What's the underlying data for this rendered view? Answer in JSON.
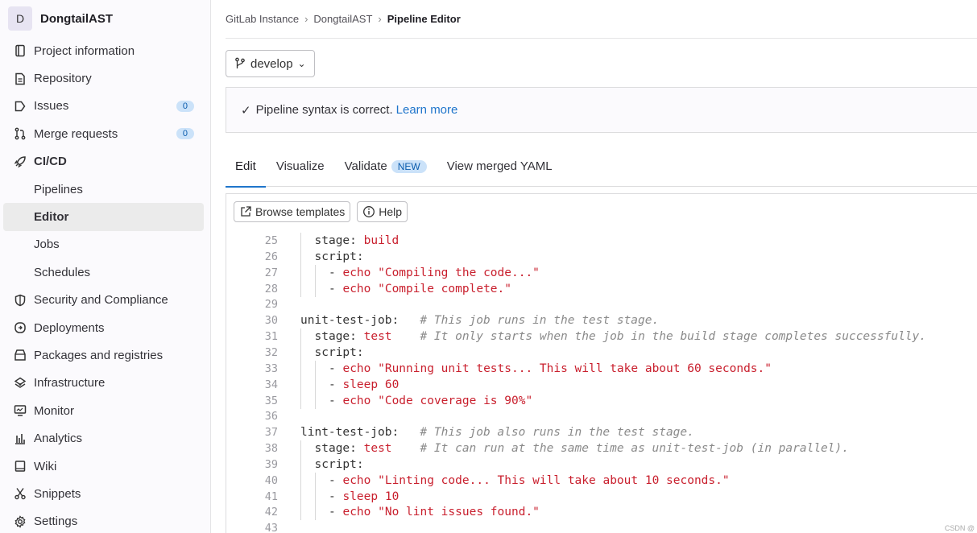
{
  "sidebar": {
    "project_initial": "D",
    "project_name": "DongtailAST",
    "items": [
      {
        "label": "Project information",
        "icon": "info-book-icon"
      },
      {
        "label": "Repository",
        "icon": "document-icon"
      },
      {
        "label": "Issues",
        "icon": "issues-icon",
        "badge": "0"
      },
      {
        "label": "Merge requests",
        "icon": "merge-request-icon",
        "badge": "0"
      },
      {
        "label": "CI/CD",
        "icon": "rocket-icon"
      },
      {
        "label": "Pipelines"
      },
      {
        "label": "Editor"
      },
      {
        "label": "Jobs"
      },
      {
        "label": "Schedules"
      },
      {
        "label": "Security and Compliance",
        "icon": "shield-icon"
      },
      {
        "label": "Deployments",
        "icon": "deployments-icon"
      },
      {
        "label": "Packages and registries",
        "icon": "package-icon"
      },
      {
        "label": "Infrastructure",
        "icon": "infrastructure-icon"
      },
      {
        "label": "Monitor",
        "icon": "monitor-icon"
      },
      {
        "label": "Analytics",
        "icon": "chart-icon"
      },
      {
        "label": "Wiki",
        "icon": "book-icon"
      },
      {
        "label": "Snippets",
        "icon": "scissors-icon"
      },
      {
        "label": "Settings",
        "icon": "gear-icon"
      }
    ]
  },
  "breadcrumb": {
    "items": [
      "GitLab Instance",
      "DongtailAST"
    ],
    "current": "Pipeline Editor"
  },
  "branch": {
    "label": "develop"
  },
  "status": {
    "text": "Pipeline syntax is correct.",
    "link": "Learn more"
  },
  "tabs": {
    "edit": "Edit",
    "visualize": "Visualize",
    "validate": "Validate",
    "validate_badge": "NEW",
    "merged": "View merged YAML"
  },
  "toolbar": {
    "browse": "Browse templates",
    "help": "Help"
  },
  "code_lines": [
    {
      "n": "25",
      "indent": 1,
      "parts": [
        [
          "k",
          "stage: "
        ],
        [
          "v",
          "build"
        ]
      ]
    },
    {
      "n": "26",
      "indent": 1,
      "parts": [
        [
          "k",
          "script:"
        ]
      ]
    },
    {
      "n": "27",
      "indent": 2,
      "parts": [
        [
          "k",
          "- "
        ],
        [
          "v",
          "echo \"Compiling the code...\""
        ]
      ]
    },
    {
      "n": "28",
      "indent": 2,
      "parts": [
        [
          "k",
          "- "
        ],
        [
          "v",
          "echo \"Compile complete.\""
        ]
      ]
    },
    {
      "n": "29",
      "indent": 0,
      "parts": []
    },
    {
      "n": "30",
      "indent": 0,
      "parts": [
        [
          "k",
          "unit-test-job:   "
        ],
        [
          "c",
          "# This job runs in the test stage."
        ]
      ]
    },
    {
      "n": "31",
      "indent": 1,
      "parts": [
        [
          "k",
          "stage: "
        ],
        [
          "v",
          "test"
        ],
        [
          "k",
          "    "
        ],
        [
          "c",
          "# It only starts when the job in the build stage completes successfully."
        ]
      ]
    },
    {
      "n": "32",
      "indent": 1,
      "parts": [
        [
          "k",
          "script:"
        ]
      ]
    },
    {
      "n": "33",
      "indent": 2,
      "parts": [
        [
          "k",
          "- "
        ],
        [
          "v",
          "echo \"Running unit tests... This will take about 60 seconds.\""
        ]
      ]
    },
    {
      "n": "34",
      "indent": 2,
      "parts": [
        [
          "k",
          "- "
        ],
        [
          "v",
          "sleep 60"
        ]
      ]
    },
    {
      "n": "35",
      "indent": 2,
      "parts": [
        [
          "k",
          "- "
        ],
        [
          "v",
          "echo \"Code coverage is 90%\""
        ]
      ]
    },
    {
      "n": "36",
      "indent": 0,
      "parts": []
    },
    {
      "n": "37",
      "indent": 0,
      "parts": [
        [
          "k",
          "lint-test-job:   "
        ],
        [
          "c",
          "# This job also runs in the test stage."
        ]
      ]
    },
    {
      "n": "38",
      "indent": 1,
      "parts": [
        [
          "k",
          "stage: "
        ],
        [
          "v",
          "test"
        ],
        [
          "k",
          "    "
        ],
        [
          "c",
          "# It can run at the same time as unit-test-job (in parallel)."
        ]
      ]
    },
    {
      "n": "39",
      "indent": 1,
      "parts": [
        [
          "k",
          "script:"
        ]
      ]
    },
    {
      "n": "40",
      "indent": 2,
      "parts": [
        [
          "k",
          "- "
        ],
        [
          "v",
          "echo \"Linting code... This will take about 10 seconds.\""
        ]
      ]
    },
    {
      "n": "41",
      "indent": 2,
      "parts": [
        [
          "k",
          "- "
        ],
        [
          "v",
          "sleep 10"
        ]
      ]
    },
    {
      "n": "42",
      "indent": 2,
      "parts": [
        [
          "k",
          "- "
        ],
        [
          "v",
          "echo \"No lint issues found.\""
        ]
      ]
    },
    {
      "n": "43",
      "indent": 0,
      "parts": []
    }
  ],
  "watermark": "CSDN @"
}
